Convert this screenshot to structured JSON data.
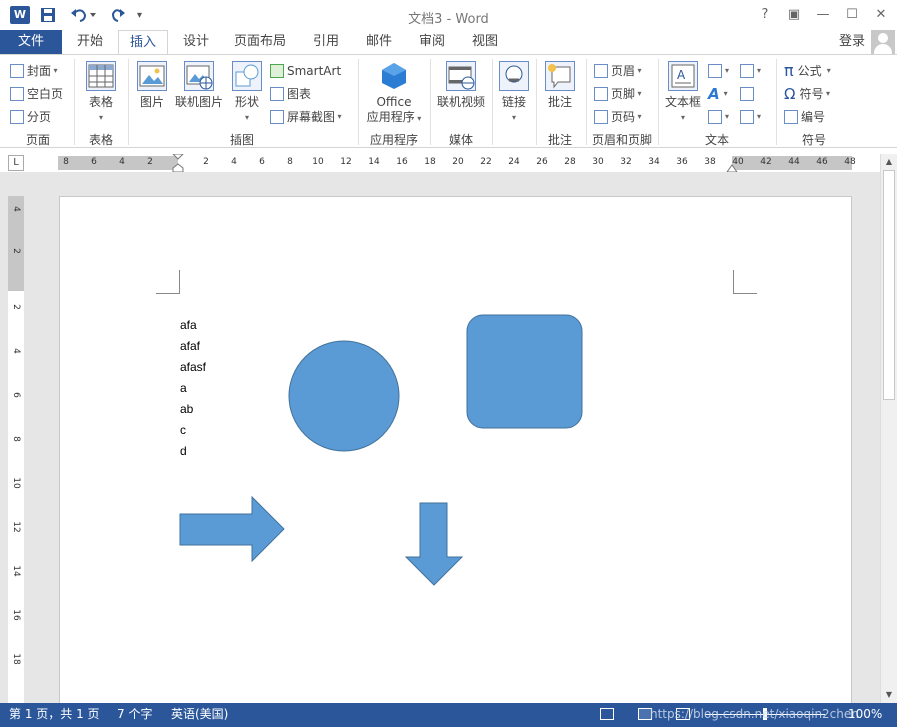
{
  "window": {
    "title": "文档3 - Word",
    "app_icon": "W",
    "help": "?",
    "restore_ribbon": "▣",
    "minimize": "—",
    "maximize": "☐",
    "close": "✕"
  },
  "tabs": {
    "file": "文件",
    "items": [
      "开始",
      "插入",
      "设计",
      "页面布局",
      "引用",
      "邮件",
      "审阅",
      "视图"
    ],
    "active_index": 1,
    "login": "登录"
  },
  "ribbon": {
    "groups": {
      "pages": "页面",
      "tables": "表格",
      "illustrations": "插图",
      "apps": "应用程序",
      "media": "媒体",
      "comments": "批注",
      "header_footer": "页眉和页脚",
      "text": "文本",
      "symbols": "符号"
    },
    "pages": {
      "cover": "封面",
      "blank": "空白页",
      "break": "分页"
    },
    "table": "表格",
    "picture": "图片",
    "online_picture": "联机图片",
    "shapes": "形状",
    "smartart": "SmartArt",
    "chart": "图表",
    "screenshot": "屏幕截图",
    "office_apps_1": "Office",
    "office_apps_2": "应用程序",
    "online_video": "联机视频",
    "link": "链接",
    "comment": "批注",
    "header": "页眉",
    "footer": "页脚",
    "page_number": "页码",
    "textbox": "文本框",
    "equation": "公式",
    "symbol": "符号",
    "number": "编号"
  },
  "ruler": {
    "corner": "L",
    "h_numbers": [
      "8",
      "6",
      "4",
      "2",
      "2",
      "4",
      "6",
      "8",
      "10",
      "12",
      "14",
      "16",
      "18",
      "20",
      "22",
      "24",
      "26",
      "28",
      "30",
      "32",
      "34",
      "36",
      "38",
      "40",
      "42",
      "44",
      "46",
      "48"
    ],
    "v_numbers": [
      "4",
      "2",
      "2",
      "4",
      "6",
      "8",
      "10",
      "12",
      "14",
      "16",
      "18"
    ]
  },
  "document": {
    "lines": [
      "afa",
      "afaf",
      "afasf",
      "a",
      "ab",
      "c",
      "d"
    ]
  },
  "shapes": {
    "fill": "#5b9bd5",
    "stroke": "#41719c"
  },
  "statusbar": {
    "page": "第 1 页，共 1 页",
    "words": "7 个字",
    "language": "英语(美国)",
    "zoom": "100%",
    "watermark": "https://blog.csdn.net/xiaoqin2chen"
  },
  "colors": {
    "accent": "#2b579a"
  }
}
